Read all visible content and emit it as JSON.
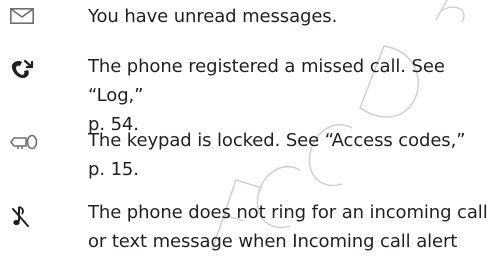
{
  "indicators": [
    {
      "icon": "envelope-icon",
      "lines": [
        "You have unread messages."
      ]
    },
    {
      "icon": "missed-call-icon",
      "lines": [
        "The phone registered a missed call. See “Log,”",
        "p. 54."
      ]
    },
    {
      "icon": "keypad-lock-icon",
      "lines": [
        "The keypad is locked. See “Access codes,”",
        "p. 15."
      ]
    },
    {
      "icon": "silent-ringtone-icon",
      "lines": [
        "The phone does not ring for an incoming call",
        "or text message when Incoming call alert"
      ]
    }
  ],
  "watermark": {
    "text": "FCC DRAFT",
    "color": "#d9d9d9"
  },
  "colors": {
    "text": "#231f20",
    "icon": "#6d6e71"
  }
}
